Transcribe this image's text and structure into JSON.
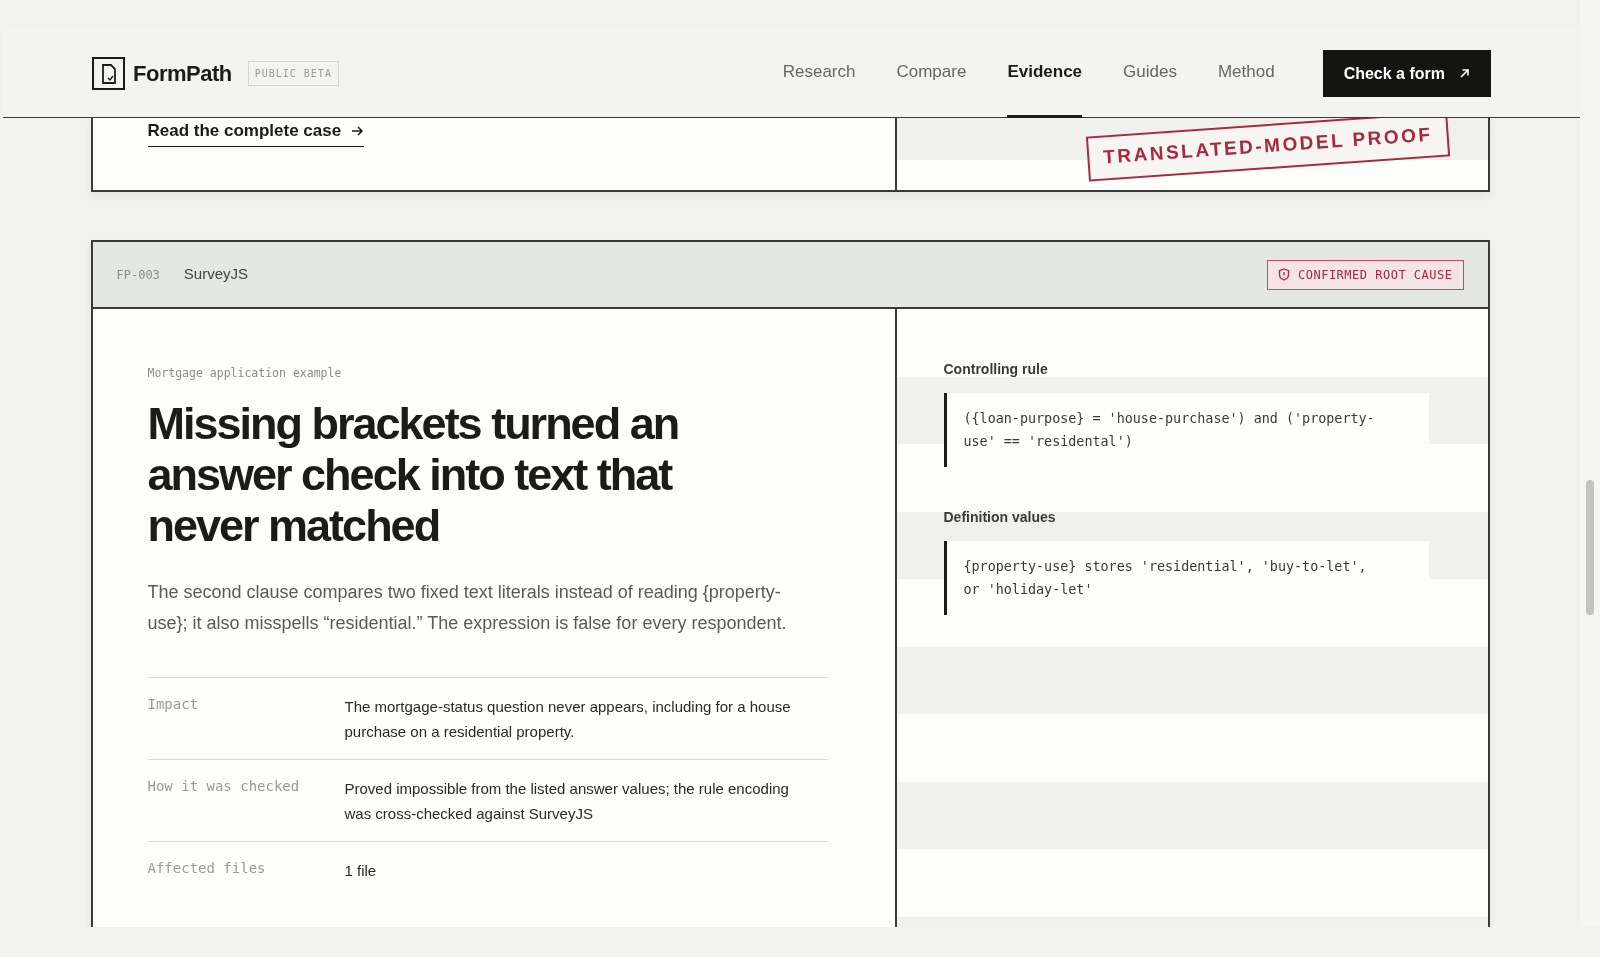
{
  "header": {
    "brand": "FormPath",
    "badge": "PUBLIC BETA",
    "nav": [
      {
        "label": "Research",
        "selected": false
      },
      {
        "label": "Compare",
        "selected": false
      },
      {
        "label": "Evidence",
        "selected": true
      },
      {
        "label": "Guides",
        "selected": false
      },
      {
        "label": "Method",
        "selected": false
      }
    ],
    "cta": "Check a form"
  },
  "previous_case": {
    "link": "Read the complete case",
    "stamp": "TRANSLATED-MODEL PROOF"
  },
  "case": {
    "id": "FP-003",
    "tool": "SurveyJS",
    "status": "CONFIRMED ROOT CAUSE",
    "eyebrow": "Mortgage application example",
    "title": "Missing brackets turned an answer check into text that never matched",
    "summary": "The second clause compares two fixed text literals instead of reading {property-use}; it also misspells “residential.” The expression is false for every respondent.",
    "details": [
      {
        "label": "Impact",
        "value": "The mortgage-status question never appears, including for a house purchase on a residential property."
      },
      {
        "label": "How it was checked",
        "value": "Proved impossible from the listed answer values; the rule encoding was cross-checked against SurveyJS"
      },
      {
        "label": "Affected files",
        "value": "1 file"
      }
    ],
    "evidence": [
      {
        "label": "Controlling rule",
        "code": "({loan-purpose} = 'house-purchase') and ('property-use' == 'residental')"
      },
      {
        "label": "Definition values",
        "code": "{property-use} stores 'residential', 'buy-to-let', or 'holiday-let'"
      }
    ]
  }
}
